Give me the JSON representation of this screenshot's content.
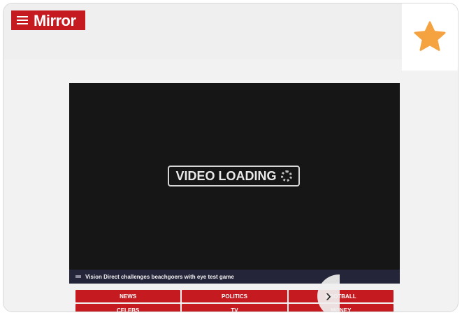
{
  "header": {
    "logo_text": "Mirror",
    "brand_color": "#c41a20"
  },
  "favorite": {
    "icon": "star-icon",
    "color": "#f4a340"
  },
  "video": {
    "loading_text": "VIDEO LOADING",
    "caption": "Vision Direct challenges beachgoers with eye test game"
  },
  "nav": {
    "items": [
      {
        "label": "NEWS"
      },
      {
        "label": "POLITICS"
      },
      {
        "label": "FOOTBALL"
      },
      {
        "label": "CELEBS"
      },
      {
        "label": "TV"
      },
      {
        "label": "MONEY"
      }
    ]
  }
}
